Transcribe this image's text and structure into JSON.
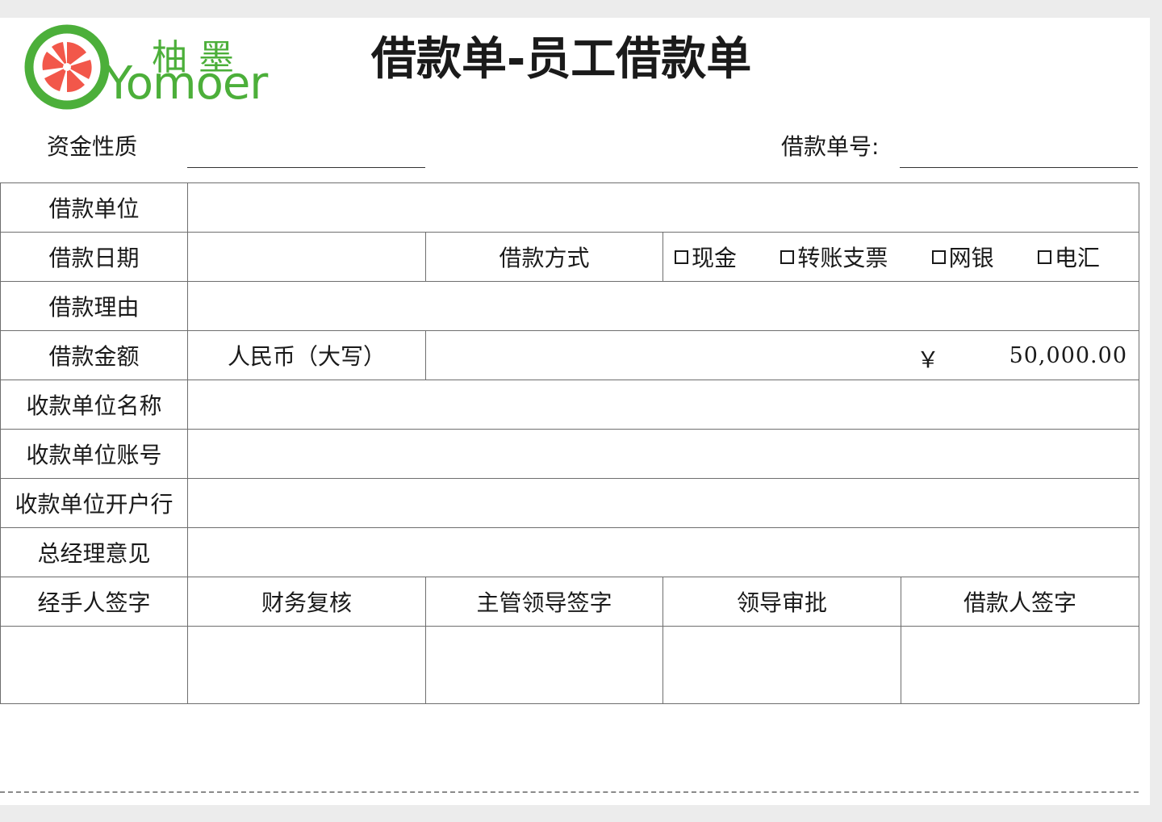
{
  "logo": {
    "name_cn": "柚墨",
    "name_en": "Yomoer",
    "icon": "grapefruit-slice-icon",
    "color": "#4caf3a",
    "accent": "#f2574a"
  },
  "title": "借款单-员工借款单",
  "meta": {
    "fund_nature_label": "资金性质",
    "loan_no_label": "借款单号:"
  },
  "rows": {
    "unit_label": "借款单位",
    "date_label": "借款日期",
    "method_label": "借款方式",
    "methods": [
      "现金",
      "转账支票",
      "网银",
      "电汇"
    ],
    "reason_label": "借款理由",
    "amount_label": "借款金额",
    "currency_words_label": "人民币（大写）",
    "currency_symbol": "￥",
    "amount_value": "50,000.00",
    "payee_name_label": "收款单位名称",
    "payee_account_label": "收款单位账号",
    "payee_bank_label": "收款单位开户行",
    "gm_opinion_label": "总经理意见"
  },
  "signatures": [
    "经手人签字",
    "财务复核",
    "主管领导签字",
    "领导审批",
    "借款人签字"
  ]
}
